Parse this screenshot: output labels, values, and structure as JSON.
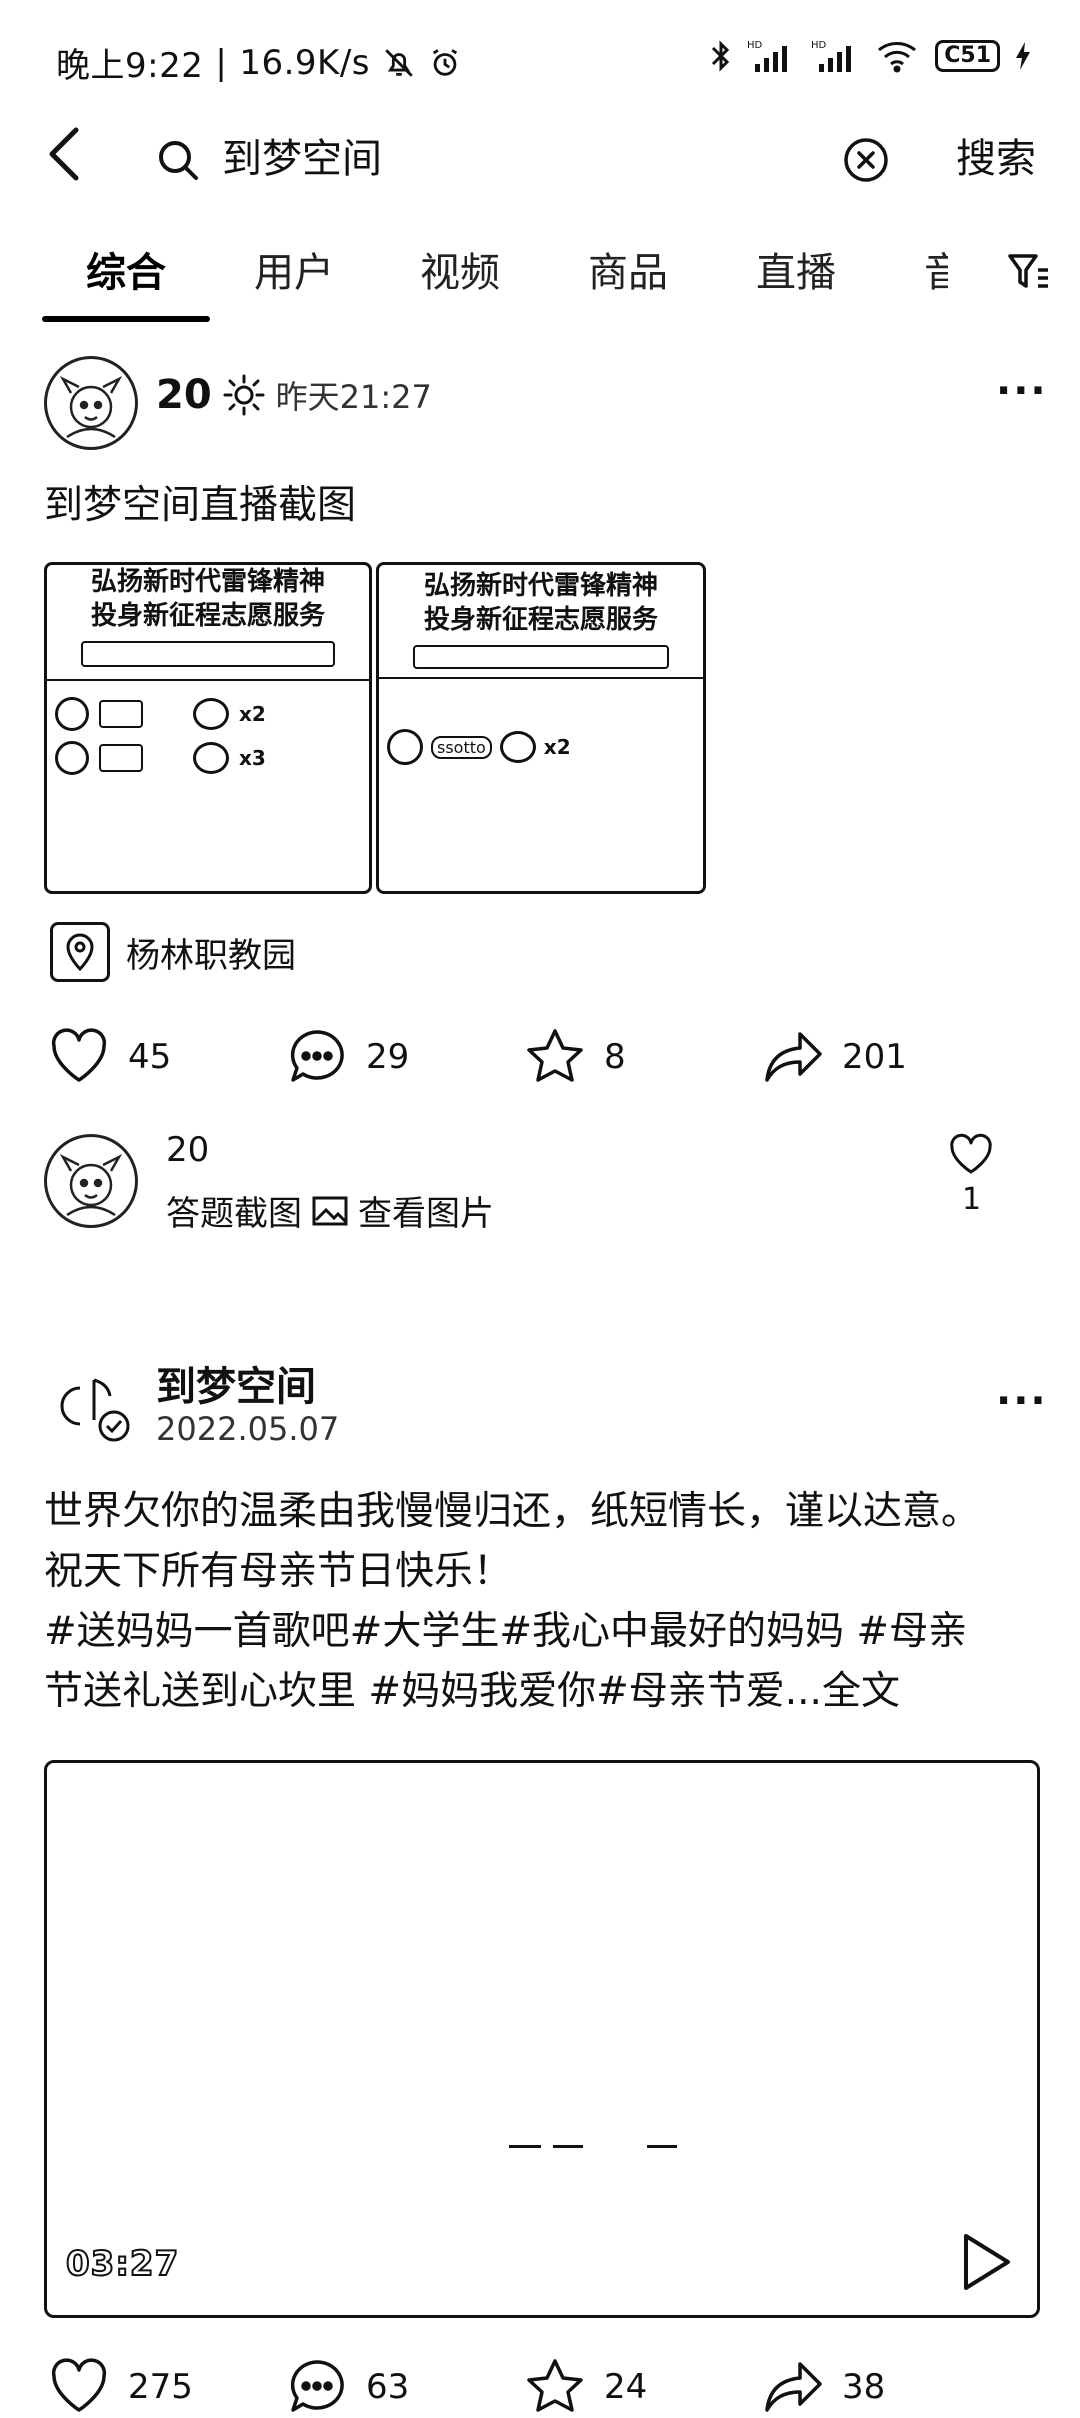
{
  "status_bar": {
    "time": "晚上9:22",
    "speed": "16.9K/s",
    "battery": "C51"
  },
  "search": {
    "query": "到梦空间",
    "button": "搜索"
  },
  "tabs": [
    "综合",
    "用户",
    "视频",
    "商品",
    "直播",
    "音"
  ],
  "post1": {
    "author": "20",
    "time": "昨天21:27",
    "text": "到梦空间直播截图",
    "thumb_title_line1": "弘扬新时代雷锋精神",
    "thumb_title_line2": "投身新征程志愿服务",
    "thumb1_label_a": "x2",
    "thumb1_label_b": "x3",
    "thumb2_label": "x2",
    "thumb2_user": "ssotto",
    "location": "杨林职教园",
    "likes": "45",
    "comments": "29",
    "favorites": "8",
    "shares": "201",
    "comment": {
      "user": "20",
      "text": "答题截图",
      "link": "查看图片",
      "likes": "1"
    }
  },
  "post2": {
    "author": "到梦空间",
    "date": "2022.05.07",
    "line1": "世界欠你的温柔由我慢慢归还，纸短情长，谨以达意。",
    "line2": "祝天下所有母亲节日快乐！",
    "line3": "#送妈妈一首歌吧#大学生#我心中最好的妈妈 #母亲",
    "line4_tags": "节送礼送到心坎里 #妈妈我爱你#母亲节爱...",
    "line4_more": "全文",
    "duration": "03:27",
    "likes": "275",
    "comments": "63",
    "favorites": "24",
    "shares": "38"
  },
  "icons": {
    "bell_off": "bell-off-icon",
    "alarm": "alarm-icon",
    "bluetooth": "bluetooth-icon",
    "wifi": "wifi-icon",
    "charging": "charging-icon",
    "sun": "sun-icon"
  }
}
